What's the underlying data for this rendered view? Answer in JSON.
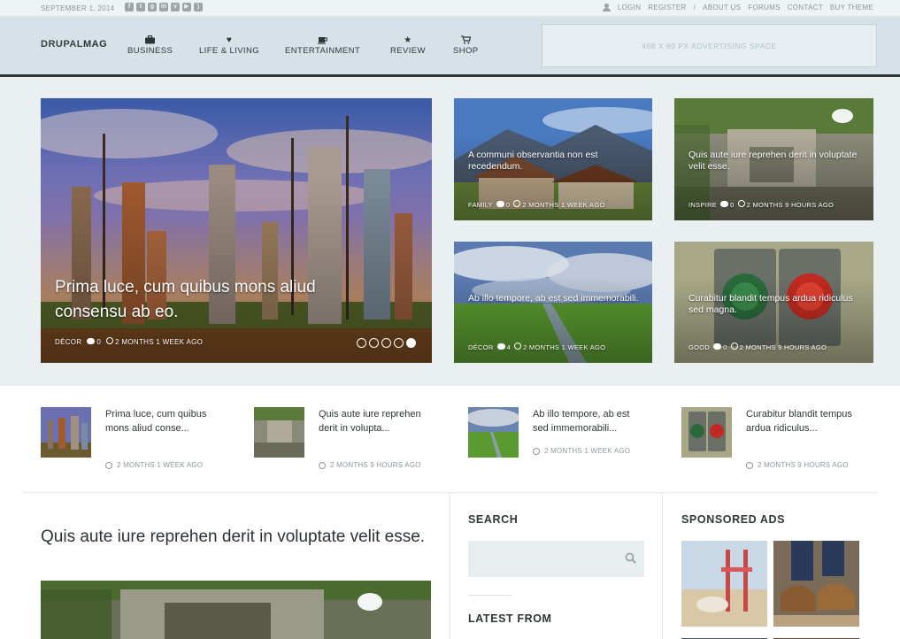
{
  "topbar": {
    "date": "SEPTEMBER 1, 2014",
    "social_icons": [
      "facebook-icon",
      "twitter-icon",
      "googleplus-icon",
      "linkedin-icon",
      "vimeo-icon",
      "youtube-icon",
      "rss-icon"
    ],
    "links": [
      "LOGIN",
      "REGISTER",
      "/",
      "ABOUT US",
      "FORUMS",
      "CONTACT",
      "BUY THEME"
    ]
  },
  "header": {
    "logo_light": "DRUPAL",
    "logo_bold": "MAG",
    "nav": [
      {
        "label": "BUSINESS",
        "icon": "briefcase-icon"
      },
      {
        "label": "LIFE & LIVING",
        "icon": "heart-icon"
      },
      {
        "label": "ENTERTAINMENT",
        "icon": "coffee-cup-icon"
      },
      {
        "label": "REVIEW",
        "icon": "star-icon"
      },
      {
        "label": "SHOP",
        "icon": "cart-icon"
      }
    ],
    "ad_text": "468 X 60 PX ADVERTISING SPACE"
  },
  "featured": {
    "main": {
      "title": "Prima luce, cum quibus mons aliud consensu ab eo.",
      "category": "DÉCOR",
      "comments": "0",
      "time": "2 MONTHS 1 WEEK AGO"
    },
    "tiles": [
      {
        "title": "A communi observantia non est recedendum.",
        "category": "FAMILY",
        "comments": "0",
        "time": "2 MONTHS 1 WEEK AGO"
      },
      {
        "title": "Quis aute iure reprehen derit in voluptate velit esse.",
        "category": "INSPIRE",
        "comments": "0",
        "time": "2 MONTHS 9 HOURS AGO"
      },
      {
        "title": "Ab illo tempore, ab est sed immemorabili.",
        "category": "DÉCOR",
        "comments": "4",
        "time": "2 MONTHS 1 WEEK AGO"
      },
      {
        "title": "Curabitur blandit tempus ardua ridiculus sed magna.",
        "category": "GOOD",
        "comments": "0",
        "time": "2 MONTHS 9 HOURS AGO"
      }
    ],
    "slide_count": 5,
    "active_slide": 5
  },
  "small_posts": [
    {
      "title": "Prima luce, cum quibus mons aliud conse...",
      "time": "2 MONTHS 1 WEEK AGO"
    },
    {
      "title": "Quis aute iure reprehen derit in volupta...",
      "time": "2 MONTHS 9 HOURS AGO"
    },
    {
      "title": "Ab illo tempore, ab est sed immemorabili...",
      "time": "2 MONTHS 1 WEEK AGO"
    },
    {
      "title": "Curabitur blandit tempus ardua ridiculus...",
      "time": "2 MONTHS 9 HOURS AGO"
    }
  ],
  "article": {
    "title": "Quis aute iure reprehen derit in voluptate velit esse."
  },
  "sidebar": {
    "search_heading": "SEARCH",
    "search_placeholder": "",
    "latest_heading": "LATEST FROM",
    "sponsored_heading": "SPONSORED ADS"
  }
}
